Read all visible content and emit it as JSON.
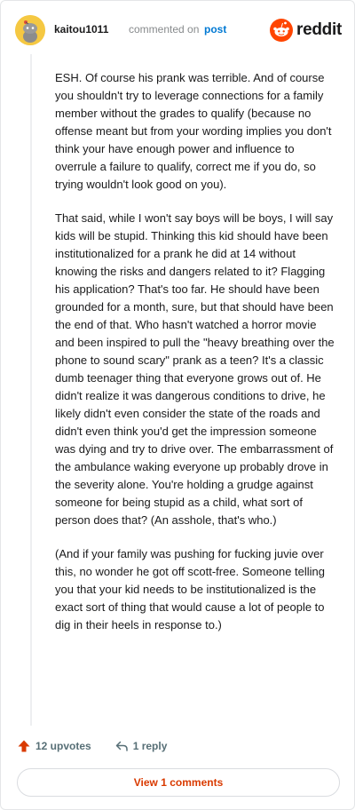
{
  "header": {
    "author": "kaitou1011",
    "action_text": "commented on",
    "post_link": "post",
    "brand": "reddit"
  },
  "comment": {
    "paragraphs": [
      "ESH. Of course his prank was terrible. And of course you shouldn't try to leverage connections for a family member without the grades to qualify (because no offense meant but from your wording implies you don't think your have enough power and influence to overrule a failure to qualify, correct me if you do, so trying wouldn't look good on you).",
      "That said, while I won't say boys will be boys, I will say kids will be stupid. Thinking this kid should have been institutionalized for a prank he did at 14 without knowing the risks and dangers related to it? Flagging his application? That's too far. He should have been grounded for a month, sure, but that should have been the end of that. Who hasn't watched a horror movie and been inspired to pull the \"heavy breathing over the phone to sound scary\" prank as a teen? It's a classic dumb teenager thing that everyone grows out of. He didn't realize it was dangerous conditions to drive, he likely didn't even consider the state of the roads and didn't even think you'd get the impression someone was dying and try to drive over. The embarrassment of the ambulance waking everyone up probably drove in the severity alone. You're holding a grudge against someone for being stupid as a child, what sort of person does that? (An asshole, that's who.)",
      "(And if your family was pushing for fucking juvie over this, no wonder he got off scott-free. Someone telling you that your kid needs to be institutionalized is the exact sort of thing that would cause a lot of people to dig in their heels in response to.)"
    ]
  },
  "actions": {
    "upvotes": "12 upvotes",
    "reply": "1 reply"
  },
  "view_button": "View 1 comments",
  "colors": {
    "accent": "#d93a00",
    "link": "#0079d3",
    "upvote": "#d93a00",
    "muted": "#576f76",
    "brand": "#ff4500"
  },
  "icons": {
    "avatar": "snoo-avatar-icon",
    "brand": "reddit-logo-icon",
    "upvote": "upvote-arrow-icon",
    "reply": "reply-arrow-icon"
  }
}
